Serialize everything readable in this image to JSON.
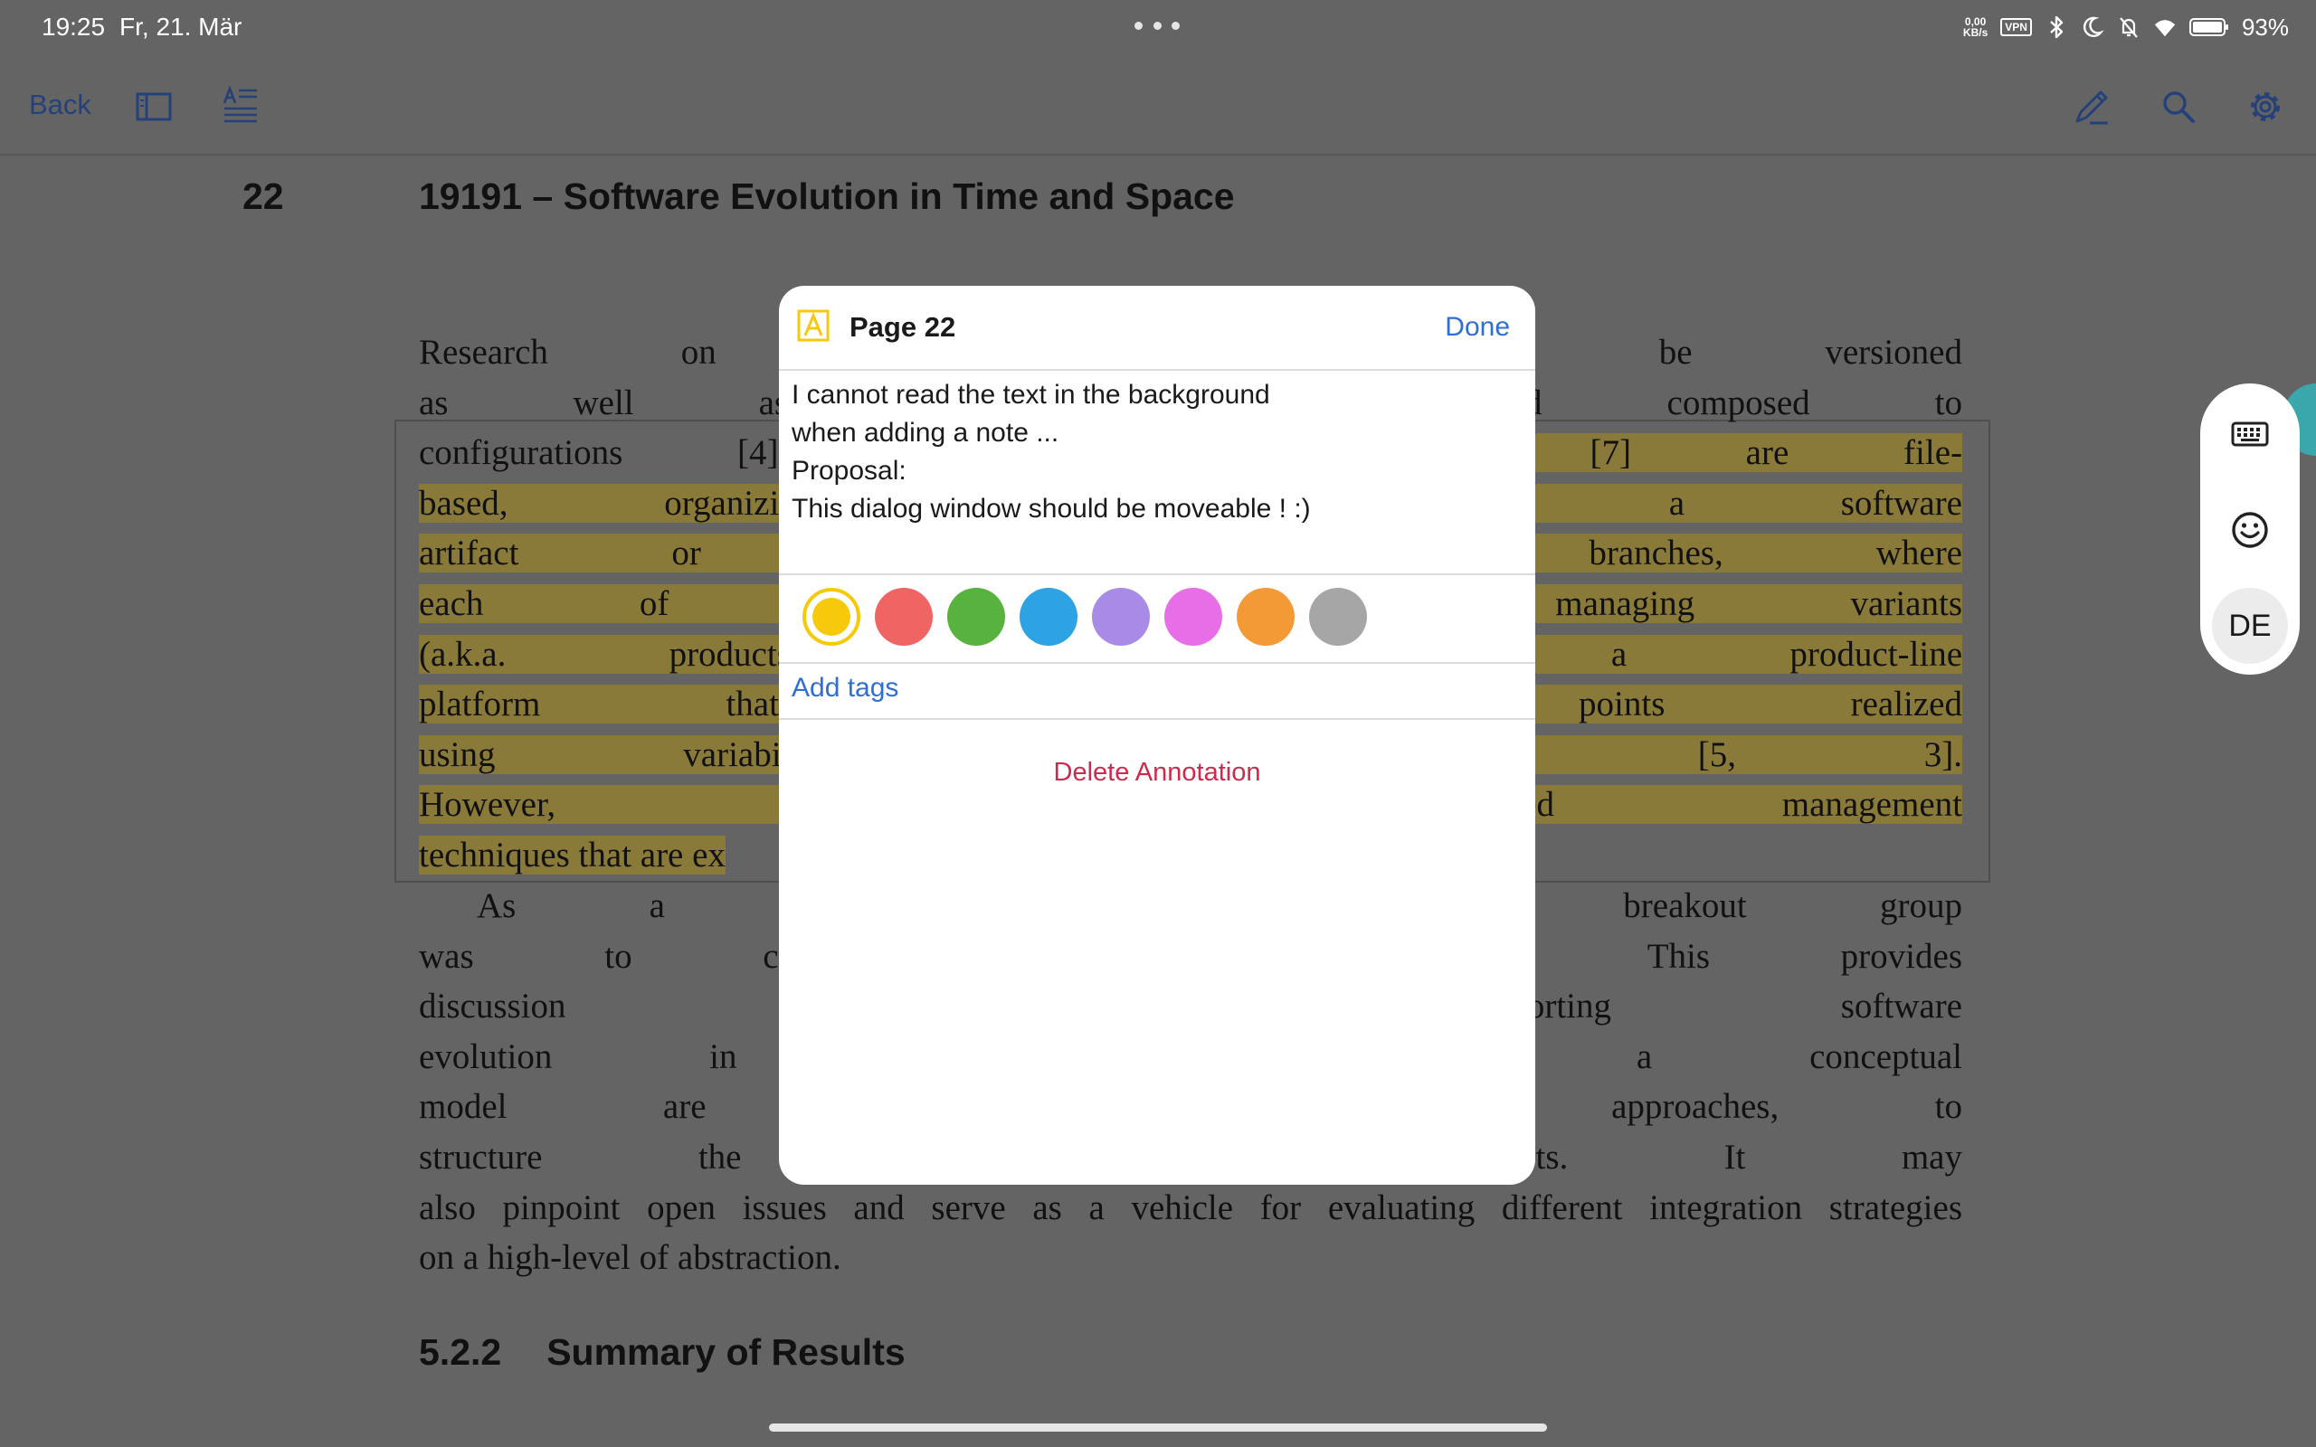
{
  "status_bar": {
    "time": "19:25",
    "date": "Fr, 21. Mär",
    "net_speed": "0,00",
    "net_unit": "KB/s",
    "vpn": "VPN",
    "battery": "93%"
  },
  "toolbar": {
    "back_label": "Back"
  },
  "document": {
    "page_number": "22",
    "title": "19191 – Software Evolution in Time and Space",
    "para1": [
      "Research on SCM has",
      "e artifacts to be versioned",
      "as well as the way i",
      "ntified and composed to",
      "configurations [4]. No",
      "rsion [9] or Git [7] are file-",
      "based, organizing vers",
      "h. Variants of a software",
      "artifact or an entire so",
      "elopment branches, where",
      "each of these branche",
      "ead of managing variants",
      "(a.k.a. products) as c",
      "to create a product-line",
      "platform that integrat",
      "t variation points realized",
      "using variability mec",
      "element exclusion [5, 3].",
      "However, neither rese",
      "cing unified management",
      "techniques that are ex",
      ""
    ],
    "para2": [
      "As a step towards",
      "oal of this breakout group",
      "was to conceive a conc",
      "E concepts. This provides",
      "discussion grounds fo",
      "logy supporting software",
      "evolution in both tim",
      "scenarios of a conceptual",
      "model are twofold. It",
      "fy existing approaches, to",
      "structure the state-of-",
      "ies’ core concepts. It may",
      "also pinpoint open issues and serve as a vehicle for evaluating different integration strategies",
      "on a high-level of abstraction."
    ],
    "section_number": "5.2.2",
    "section_title": "Summary of Results"
  },
  "dialog": {
    "title": "Page 22",
    "done_label": "Done",
    "note_lines": [
      "I cannot read the text in the background",
      "when adding a note ...",
      "Proposal:",
      "This dialog window should be moveable !  :)"
    ],
    "colors": [
      "#f7c90b",
      "#f06464",
      "#57b33e",
      "#2ea3e3",
      "#a88be6",
      "#e86ee8",
      "#f39a37",
      "#a6a6a6"
    ],
    "selected_color_index": 0,
    "add_tags_label": "Add tags",
    "delete_label": "Delete Annotation"
  },
  "keyboard_panel": {
    "language_label": "DE"
  }
}
